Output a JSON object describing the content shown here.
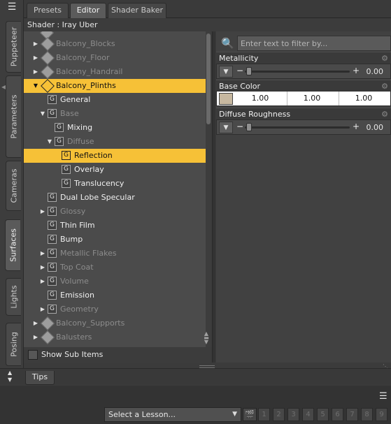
{
  "top_tabs": [
    {
      "label": "Presets",
      "active": false
    },
    {
      "label": "Editor",
      "active": true
    },
    {
      "label": "Shader Baker",
      "active": false
    }
  ],
  "side_tabs": [
    {
      "label": "Puppeteer",
      "active": false
    },
    {
      "label": "Parameters",
      "active": false
    },
    {
      "label": "Cameras",
      "active": false
    },
    {
      "label": "Surfaces",
      "active": true
    },
    {
      "label": "Lights",
      "active": false
    },
    {
      "label": "Posing",
      "active": false
    }
  ],
  "shader_label": "Shader : Iray Uber",
  "tree": [
    {
      "label": "Balcony_Blocks",
      "icon": "material",
      "expander": "collapsed",
      "style": "dim",
      "selected": false
    },
    {
      "label": "Balcony_Floor",
      "icon": "material",
      "expander": "collapsed",
      "style": "dim",
      "selected": false
    },
    {
      "label": "Balcony_Handrail",
      "icon": "material",
      "expander": "collapsed",
      "style": "dim",
      "selected": false
    },
    {
      "label": "Balcony_Plinths",
      "icon": "material",
      "expander": "expanded",
      "style": "bright",
      "selected": true
    },
    {
      "label": "General",
      "icon": "group",
      "expander": "none",
      "style": "bright",
      "selected": false
    },
    {
      "label": "Base",
      "icon": "group",
      "expander": "expanded",
      "style": "dim",
      "selected": false
    },
    {
      "label": "Mixing",
      "icon": "group",
      "expander": "none",
      "style": "bright",
      "selected": false
    },
    {
      "label": "Diffuse",
      "icon": "group",
      "expander": "expanded",
      "style": "dim",
      "selected": false
    },
    {
      "label": "Reflection",
      "icon": "group",
      "expander": "none",
      "style": "bright",
      "selected": true
    },
    {
      "label": "Overlay",
      "icon": "group",
      "expander": "none",
      "style": "bright",
      "selected": false
    },
    {
      "label": "Translucency",
      "icon": "group",
      "expander": "none",
      "style": "bright",
      "selected": false
    },
    {
      "label": "Dual Lobe Specular",
      "icon": "group",
      "expander": "none",
      "style": "bright",
      "selected": false
    },
    {
      "label": "Glossy",
      "icon": "group",
      "expander": "collapsed",
      "style": "dim",
      "selected": false
    },
    {
      "label": "Thin Film",
      "icon": "group",
      "expander": "none",
      "style": "bright",
      "selected": false
    },
    {
      "label": "Bump",
      "icon": "group",
      "expander": "none",
      "style": "bright",
      "selected": false
    },
    {
      "label": "Metallic Flakes",
      "icon": "group",
      "expander": "collapsed",
      "style": "dim",
      "selected": false
    },
    {
      "label": "Top Coat",
      "icon": "group",
      "expander": "collapsed",
      "style": "dim",
      "selected": false
    },
    {
      "label": "Volume",
      "icon": "group",
      "expander": "collapsed",
      "style": "dim",
      "selected": false
    },
    {
      "label": "Emission",
      "icon": "group",
      "expander": "none",
      "style": "bright",
      "selected": false
    },
    {
      "label": "Geometry",
      "icon": "group",
      "expander": "collapsed",
      "style": "dim",
      "selected": false
    },
    {
      "label": "Balcony_Supports",
      "icon": "material",
      "expander": "collapsed",
      "style": "dim",
      "selected": false
    },
    {
      "label": "Balusters",
      "icon": "material",
      "expander": "collapsed",
      "style": "dim",
      "selected": false
    }
  ],
  "show_sub_items": {
    "label": "Show Sub Items",
    "checked": false
  },
  "filter": {
    "placeholder": "Enter text to filter by..."
  },
  "properties": {
    "metallicity": {
      "label": "Metallicity",
      "value": "0.00",
      "level": 0.0
    },
    "base_color": {
      "label": "Base Color",
      "r": "1.00",
      "g": "1.00",
      "b": "1.00",
      "swatch": "#c7b8a0"
    },
    "diffuse_roughness": {
      "label": "Diffuse Roughness",
      "value": "0.00",
      "level": 0.0
    }
  },
  "tips_tab": "Tips",
  "lesson_select": {
    "value": "Select a Lesson..."
  },
  "lesson_steps": [
    "1",
    "2",
    "3",
    "4",
    "5",
    "6",
    "7",
    "8",
    "9"
  ],
  "colors": {
    "selection": "#f6c137",
    "panel": "#4b4b4b"
  }
}
